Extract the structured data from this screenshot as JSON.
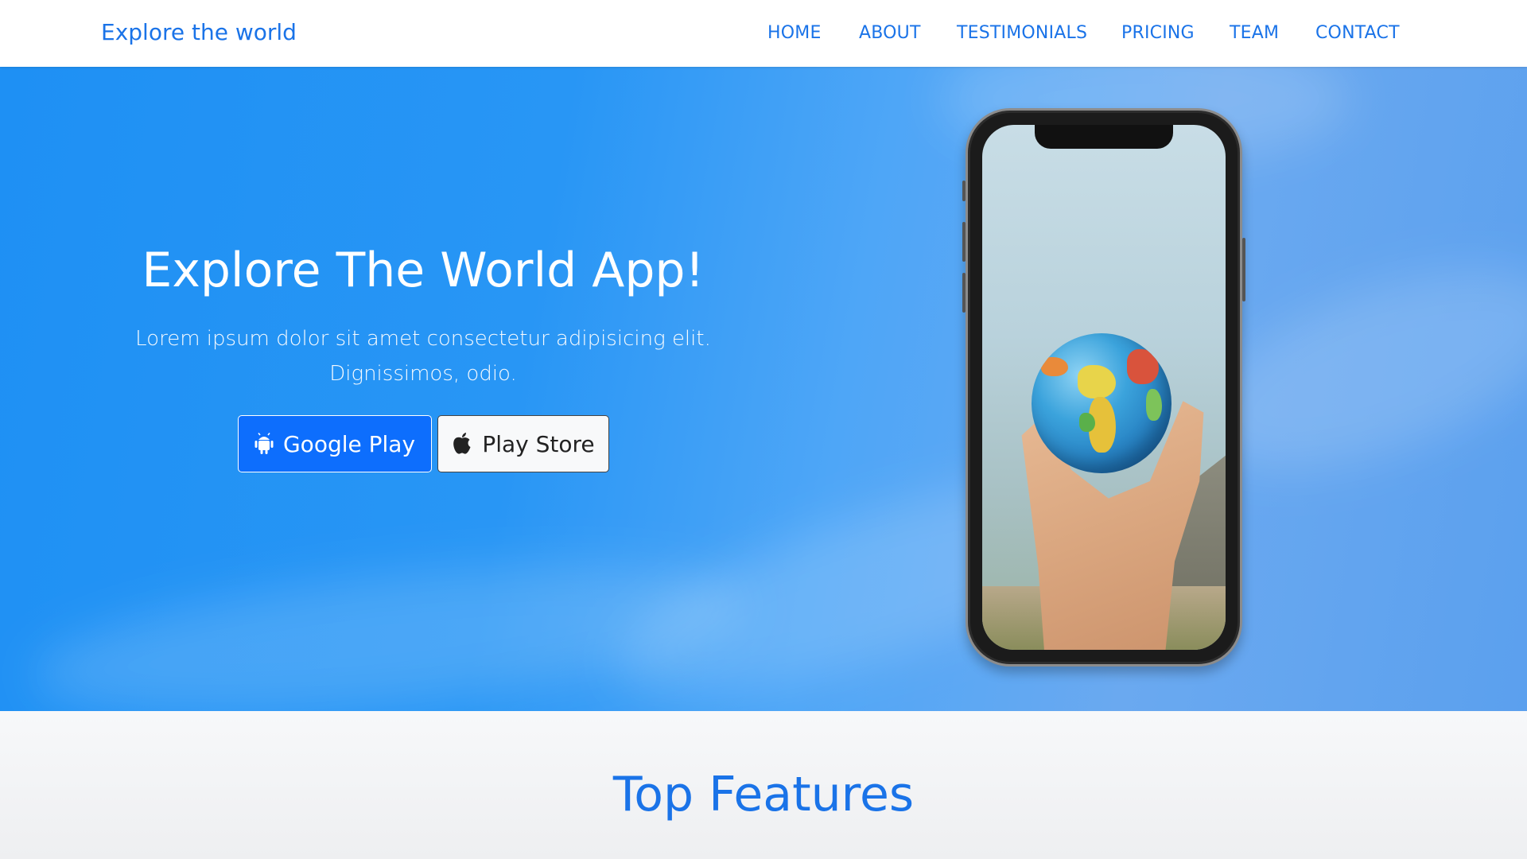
{
  "navbar": {
    "brand": "Explore the world",
    "links": [
      "HOME",
      "ABOUT",
      "TESTIMONIALS",
      "PRICING",
      "TEAM",
      "CONTACT"
    ]
  },
  "hero": {
    "title": "Explore The World App!",
    "subtitle": "Lorem ipsum dolor sit amet consectetur adipisicing elit. Dignissimos, odio.",
    "buttons": {
      "google_play": {
        "label": "Google Play",
        "icon": "android-icon"
      },
      "play_store": {
        "label": "Play Store",
        "icon": "apple-icon"
      }
    },
    "image": "phone-with-globe-in-hand"
  },
  "features": {
    "title": "Top Features"
  },
  "colors": {
    "accent": "#1a73e8",
    "primary_button": "#0d6efd",
    "hero_background": "#2196f3"
  }
}
